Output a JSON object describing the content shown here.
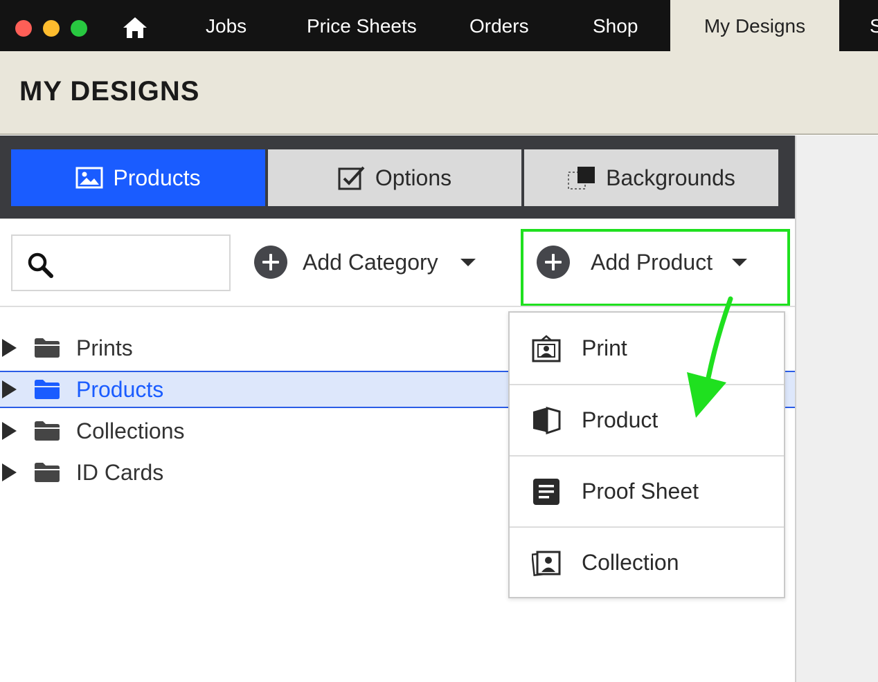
{
  "nav": {
    "items": [
      {
        "label": "Jobs"
      },
      {
        "label": "Price Sheets"
      },
      {
        "label": "Orders"
      },
      {
        "label": "Shop"
      },
      {
        "label": "My Designs",
        "active": true
      },
      {
        "label": "S"
      }
    ],
    "home_icon": "home-icon"
  },
  "page": {
    "title": "MY DESIGNS"
  },
  "tabs": [
    {
      "label": "Products",
      "icon": "image-icon",
      "active": true
    },
    {
      "label": "Options",
      "icon": "checkbox-icon"
    },
    {
      "label": "Backgrounds",
      "icon": "background-layers-icon"
    }
  ],
  "toolbar": {
    "search_placeholder": "",
    "add_category_label": "Add Category",
    "add_product_label": "Add Product"
  },
  "tree": {
    "items": [
      {
        "label": "Prints"
      },
      {
        "label": "Products",
        "selected": true
      },
      {
        "label": "Collections"
      },
      {
        "label": "ID Cards"
      }
    ]
  },
  "dropdown": {
    "items": [
      {
        "label": "Print",
        "icon": "framed-portrait-icon"
      },
      {
        "label": "Product",
        "icon": "book-icon"
      },
      {
        "label": "Proof Sheet",
        "icon": "document-lines-icon"
      },
      {
        "label": "Collection",
        "icon": "stacked-photos-icon"
      }
    ]
  },
  "colors": {
    "accent_blue": "#1a5cff",
    "highlight_green": "#1fe01f",
    "nav_bg": "#131313",
    "header_bg": "#e9e6da"
  }
}
